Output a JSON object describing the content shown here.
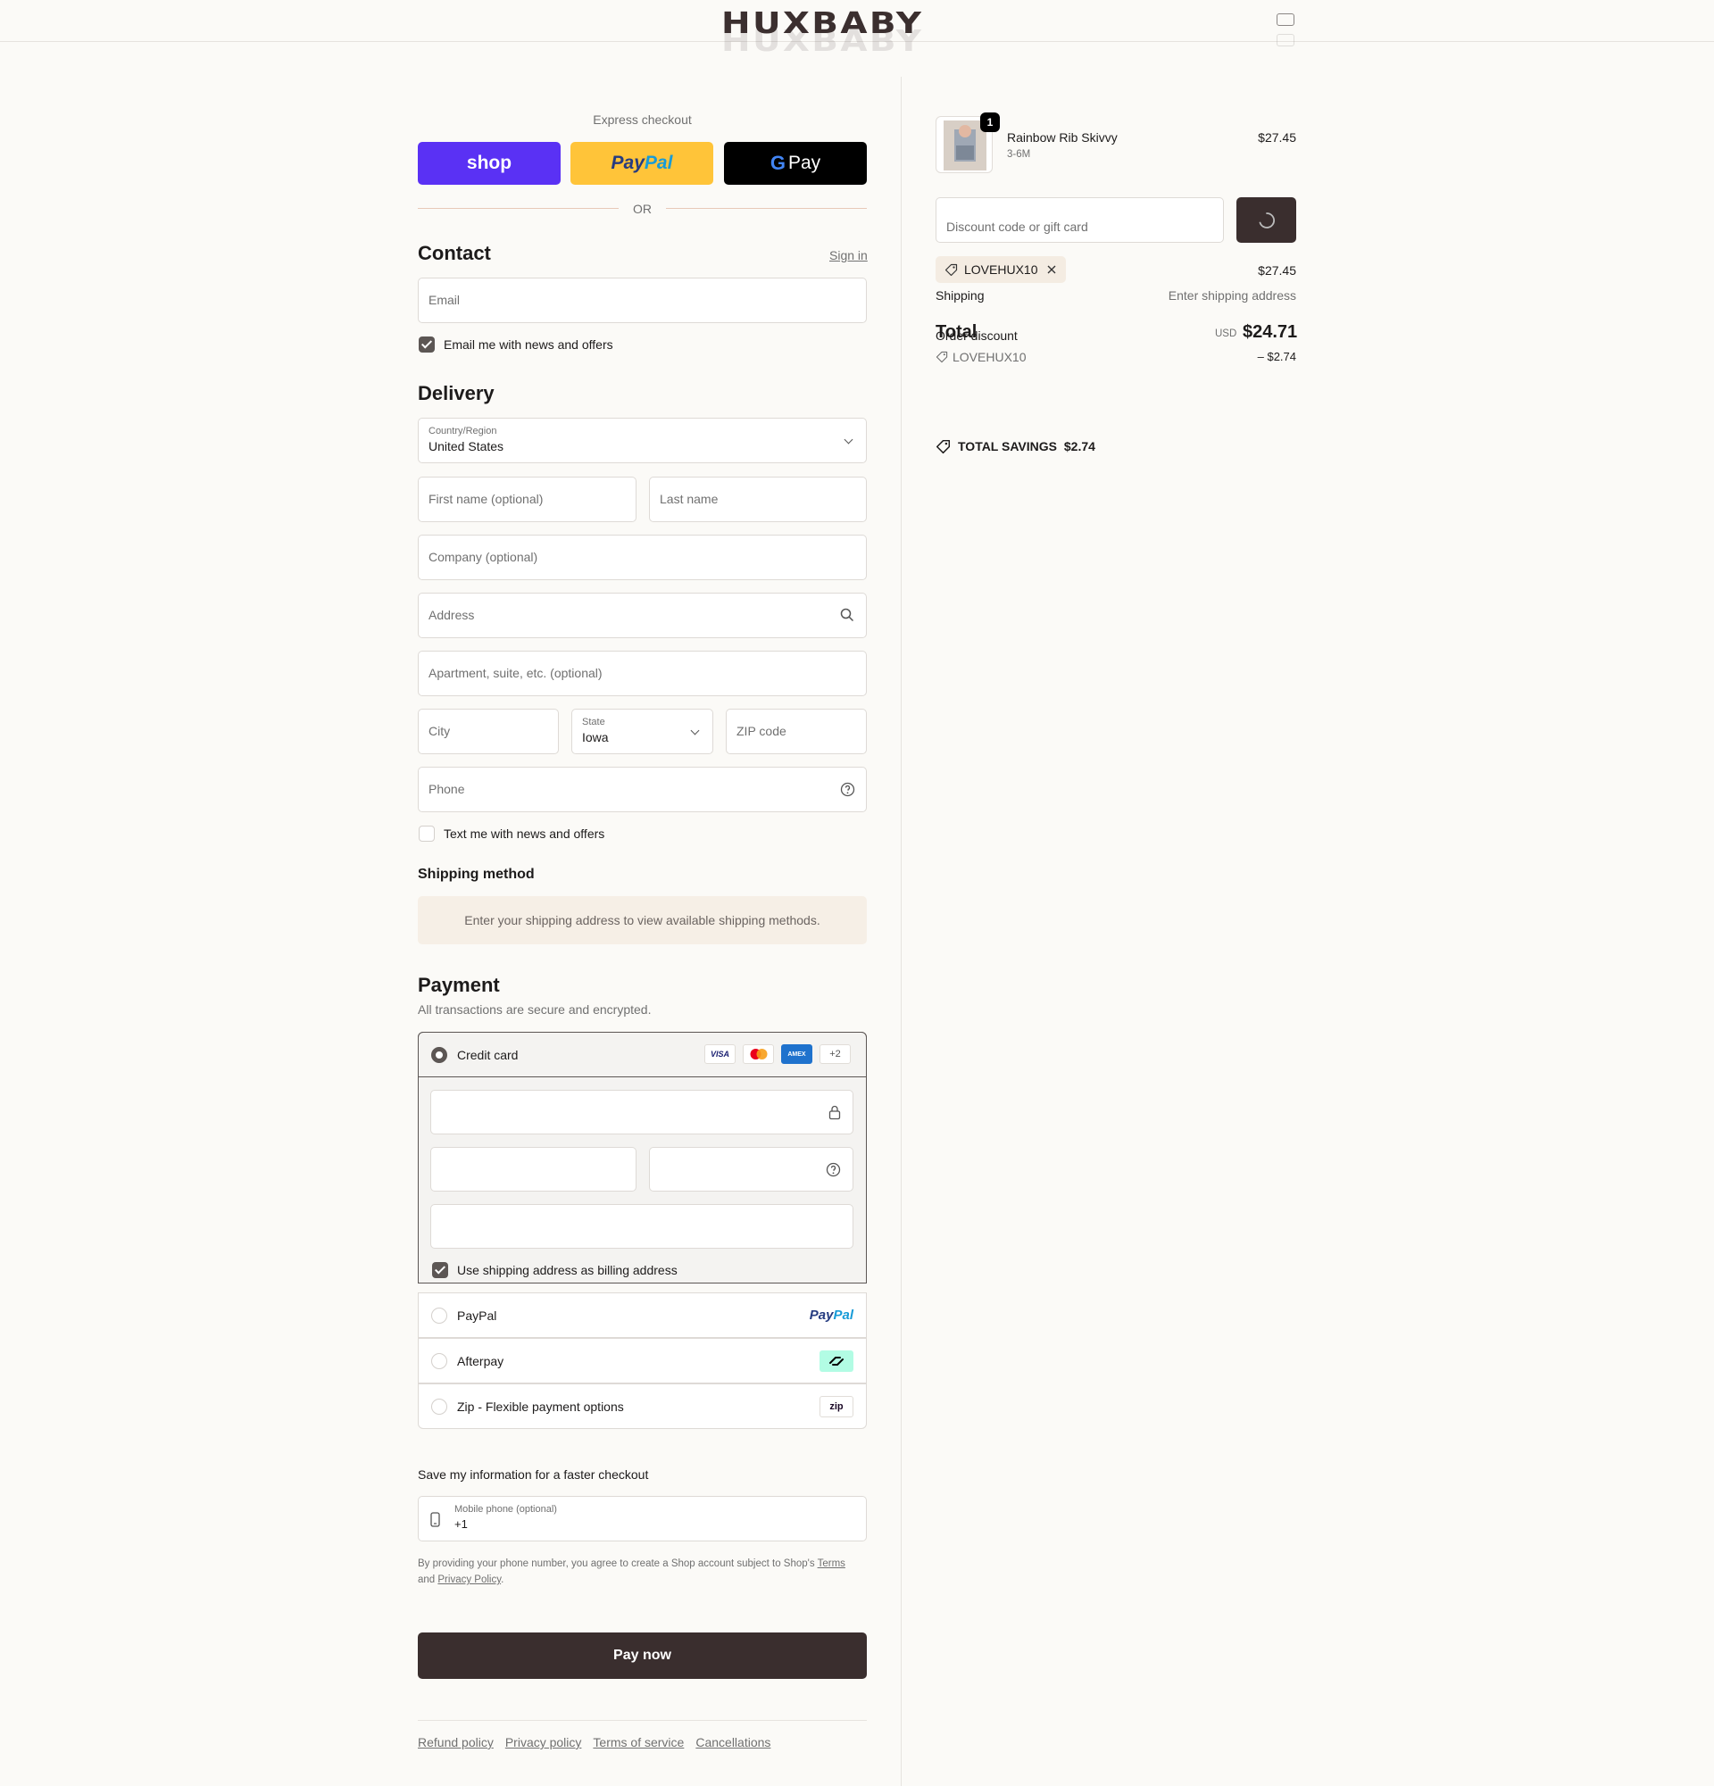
{
  "header": {
    "logo": "HUXBABY",
    "cart_icon": "bag-icon"
  },
  "express": {
    "title": "Express checkout",
    "shop_label": "shop",
    "paypal_pay": "Pay",
    "paypal_pal": "Pal",
    "gpay_g": "G",
    "gpay_label": "Pay",
    "or": "OR"
  },
  "contact": {
    "title": "Contact",
    "sign_in": "Sign in",
    "email_placeholder": "Email",
    "newsletter_label": "Email me with news and offers",
    "newsletter_checked": true
  },
  "delivery": {
    "title": "Delivery",
    "country_label": "Country/Region",
    "country_value": "United States",
    "first_name_placeholder": "First name (optional)",
    "last_name_placeholder": "Last name",
    "company_placeholder": "Company (optional)",
    "address_placeholder": "Address",
    "apartment_placeholder": "Apartment, suite, etc. (optional)",
    "city_placeholder": "City",
    "state_label": "State",
    "state_value": "Iowa",
    "zip_placeholder": "ZIP code",
    "phone_placeholder": "Phone",
    "sms_label": "Text me with news and offers",
    "sms_checked": false
  },
  "shipping_method": {
    "title": "Shipping method",
    "notice": "Enter your shipping address to view available shipping methods."
  },
  "payment": {
    "title": "Payment",
    "subtitle": "All transactions are secure and encrypted.",
    "credit_card_label": "Credit card",
    "card_brands": [
      "VISA",
      "AMEX",
      "+2"
    ],
    "billing_same_label": "Use shipping address as billing address",
    "billing_same_checked": true,
    "paypal_label": "PayPal",
    "paypal_logo_pay": "Pay",
    "paypal_logo_pal": "Pal",
    "afterpay_label": "Afterpay",
    "zip_label": "Zip - Flexible payment options",
    "zip_logo": "zip"
  },
  "save_info": {
    "title": "Save my information for a faster checkout",
    "mobile_label": "Mobile phone (optional)",
    "mobile_value": "+1",
    "legal_prefix": "By providing your phone number, you agree to create a Shop account subject to Shop's ",
    "legal_terms": "Terms",
    "legal_and": "and ",
    "legal_privacy": "Privacy Policy",
    "legal_suffix": "."
  },
  "pay_now": "Pay now",
  "footer_links": [
    "Refund policy",
    "Privacy policy",
    "Terms of service",
    "Cancellations"
  ],
  "summary": {
    "item": {
      "name": "Rainbow Rib Skivvy",
      "variant": "3-6M",
      "price": "$27.45",
      "quantity": "1"
    },
    "discount_placeholder": "Discount code or gift card",
    "applied_code": "LOVEHUX10",
    "subtotal_value": "$27.45",
    "shipping_label": "Shipping",
    "shipping_value": "Enter shipping address",
    "total_label": "Total",
    "order_discount_label": "Order discount",
    "total_currency": "USD",
    "total_value": "$24.71",
    "discount_code_line": "LOVEHUX10",
    "discount_amount": "– $2.74",
    "savings_label": "TOTAL SAVINGS",
    "savings_value": "$2.74"
  },
  "colors": {
    "shop_purple": "#5a31f4",
    "paypal_yellow": "#ffc439",
    "dark_button": "#3a2e2e",
    "background": "#fbfaf7"
  }
}
